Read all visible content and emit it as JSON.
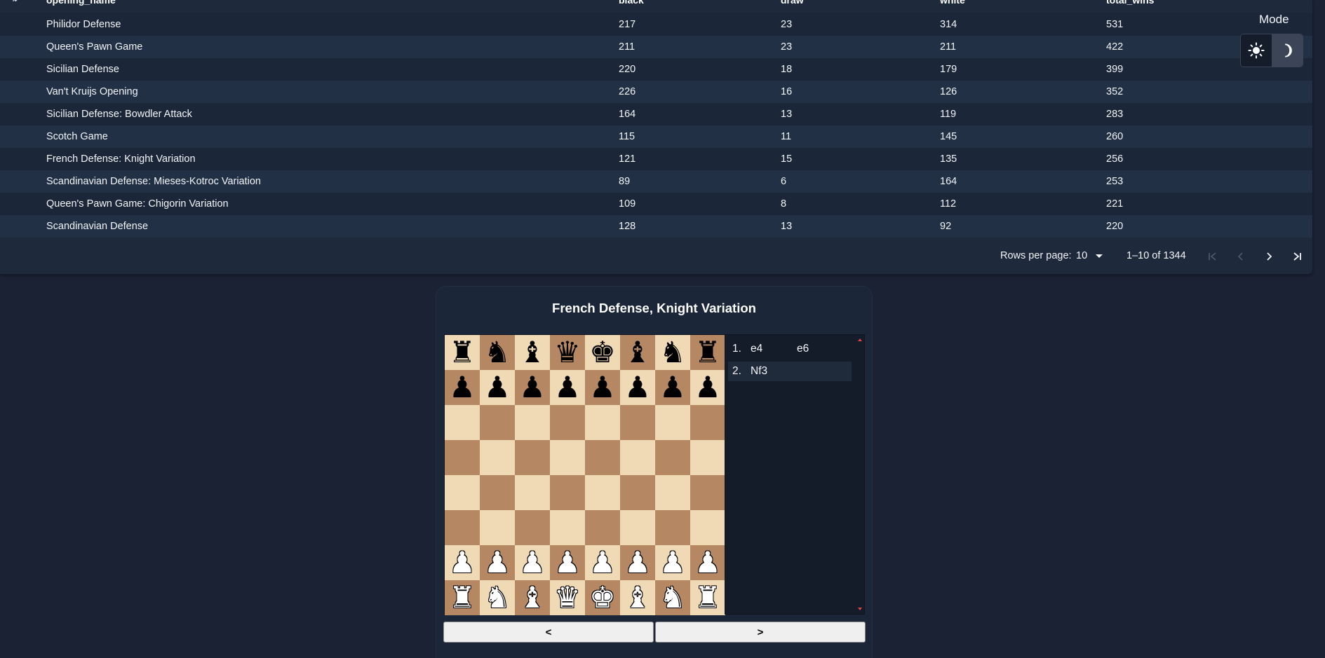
{
  "table": {
    "columns": [
      "opening_name",
      "black",
      "draw",
      "white",
      "total_wins"
    ],
    "rows": [
      [
        "Philidor Defense",
        "217",
        "23",
        "314",
        "531"
      ],
      [
        "Queen's Pawn Game",
        "211",
        "23",
        "211",
        "422"
      ],
      [
        "Sicilian Defense",
        "220",
        "18",
        "179",
        "399"
      ],
      [
        "Van't Kruijs Opening",
        "226",
        "16",
        "126",
        "352"
      ],
      [
        "Sicilian Defense: Bowdler Attack",
        "164",
        "13",
        "119",
        "283"
      ],
      [
        "Scotch Game",
        "115",
        "11",
        "145",
        "260"
      ],
      [
        "French Defense: Knight Variation",
        "121",
        "15",
        "135",
        "256"
      ],
      [
        "Scandinavian Defense: Mieses-Kotroc Variation",
        "89",
        "6",
        "164",
        "253"
      ],
      [
        "Queen's Pawn Game: Chigorin Variation",
        "109",
        "8",
        "112",
        "221"
      ],
      [
        "Scandinavian Defense",
        "128",
        "13",
        "92",
        "220"
      ]
    ]
  },
  "pagination": {
    "rows_per_page_label": "Rows per page:",
    "rows_per_page_value": "10",
    "range_text": "1–10 of 1344"
  },
  "mode": {
    "label": "Mode",
    "options": [
      "light-mode-icon",
      "dark-mode-icon"
    ],
    "selected": "dark"
  },
  "chess": {
    "title": "French Defense, Knight Variation",
    "board": [
      [
        "bR",
        "bN",
        "bB",
        "bQ",
        "bK",
        "bB",
        "bN",
        "bR"
      ],
      [
        "bP",
        "bP",
        "bP",
        "bP",
        "bP",
        "bP",
        "bP",
        "bP"
      ],
      [
        "",
        "",
        "",
        "",
        "",
        "",
        "",
        ""
      ],
      [
        "",
        "",
        "",
        "",
        "",
        "",
        "",
        ""
      ],
      [
        "",
        "",
        "",
        "",
        "",
        "",
        "",
        ""
      ],
      [
        "",
        "",
        "",
        "",
        "",
        "",
        "",
        ""
      ],
      [
        "wP",
        "wP",
        "wP",
        "wP",
        "wP",
        "wP",
        "wP",
        "wP"
      ],
      [
        "wR",
        "wN",
        "wB",
        "wQ",
        "wK",
        "wB",
        "wN",
        "wR"
      ]
    ],
    "moves": [
      {
        "num": "1.",
        "white": "e4",
        "black": "e6"
      },
      {
        "num": "2.",
        "white": "Nf3",
        "black": ""
      }
    ],
    "active_move_index": 1,
    "prev_label": "<",
    "next_label": ">"
  },
  "colors": {
    "light_square": "#f0d9b5",
    "dark_square": "#b58863",
    "page_background": "#1a2233",
    "panel_background": "#1e293b"
  }
}
